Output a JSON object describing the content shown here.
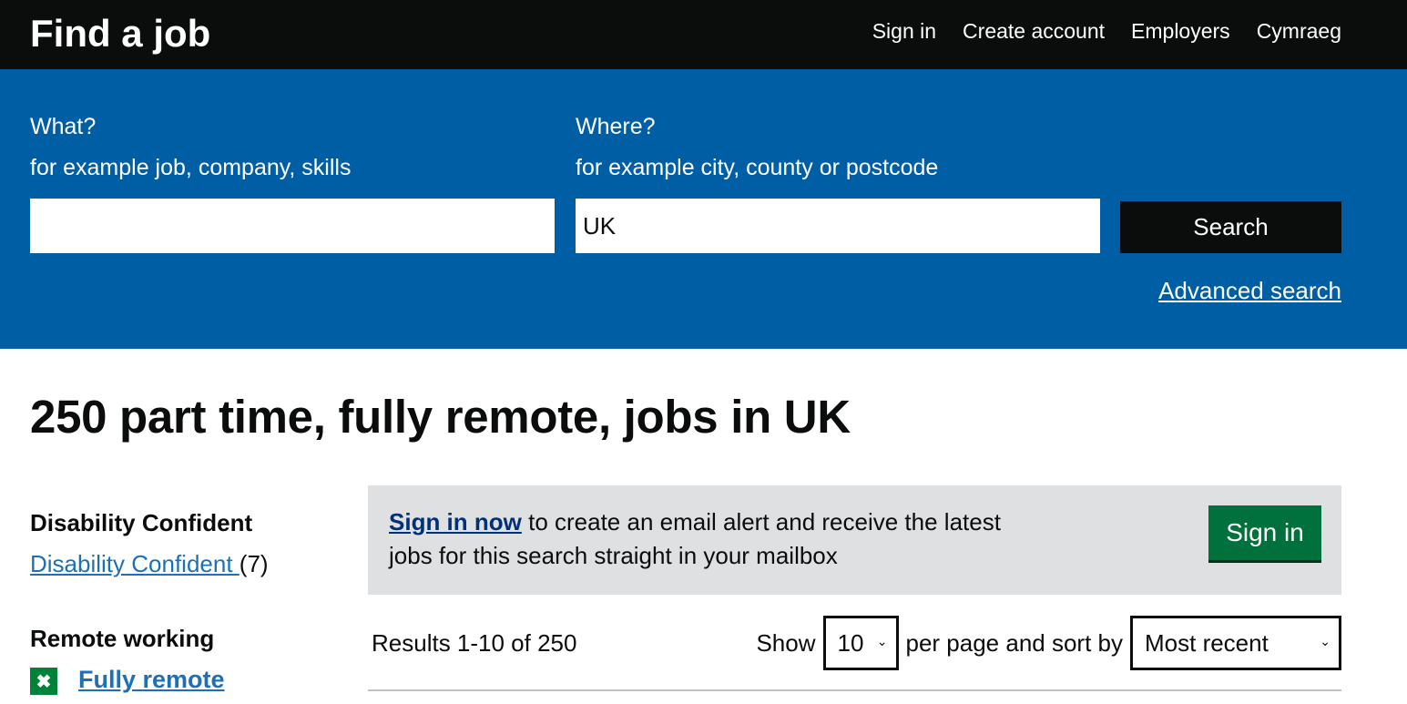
{
  "header": {
    "brand": "Find a job",
    "nav": [
      {
        "label": "Sign in"
      },
      {
        "label": "Create account"
      },
      {
        "label": "Employers"
      },
      {
        "label": "Cymraeg"
      }
    ]
  },
  "search": {
    "what_label": "What?",
    "what_hint": "for example job, company, skills",
    "what_value": "",
    "where_label": "Where?",
    "where_hint": "for example city, county or postcode",
    "where_value": "UK",
    "search_button": "Search",
    "advanced_link": "Advanced search"
  },
  "page_title": "250 part time, fully remote, jobs in UK",
  "filters": {
    "disability": {
      "heading": "Disability Confident",
      "link": "Disability Confident ",
      "count": "(7)"
    },
    "remote": {
      "heading": "Remote working",
      "active_filter": "Fully remote",
      "remove_icon": "close-icon"
    }
  },
  "alert": {
    "link": "Sign in now",
    "text": " to create an email alert and receive the latest jobs for this search straight in your mailbox",
    "button": "Sign in"
  },
  "results": {
    "count_text": "Results 1-10 of 250",
    "show_label": "Show",
    "per_page_value": "10",
    "sort_label": "per page and sort by",
    "sort_value": "Most recent"
  },
  "colors": {
    "header_bg": "#0b0c0c",
    "search_band_bg": "#005ea5",
    "link": "#1d70b8",
    "alert_bg": "#dee0e2",
    "primary_button": "#00703c",
    "remove_filter": "#00823b"
  }
}
